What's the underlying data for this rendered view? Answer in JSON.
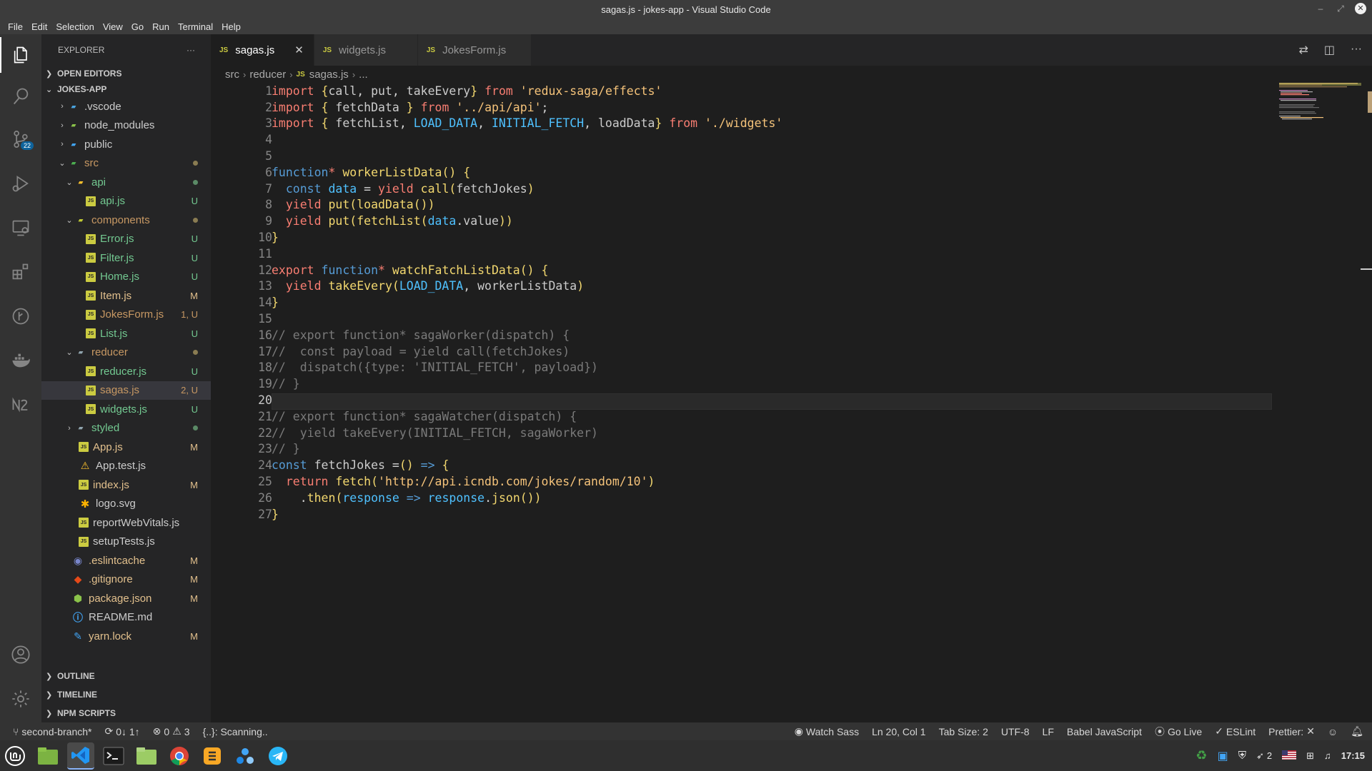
{
  "window": {
    "title": "sagas.js - jokes-app - Visual Studio Code"
  },
  "menu": [
    "File",
    "Edit",
    "Selection",
    "View",
    "Go",
    "Run",
    "Terminal",
    "Help"
  ],
  "activity": {
    "scm_badge": "22"
  },
  "explorer": {
    "header": "EXPLORER",
    "more": "···",
    "open_editors": "OPEN EDITORS",
    "project": "JOKES-APP",
    "tree": [
      {
        "label": ".vscode",
        "status": ""
      },
      {
        "label": "node_modules",
        "status": ""
      },
      {
        "label": "public",
        "status": ""
      },
      {
        "label": "src",
        "status": ""
      },
      {
        "label": "api",
        "status": ""
      },
      {
        "label": "api.js",
        "status": "U"
      },
      {
        "label": "components",
        "status": ""
      },
      {
        "label": "Error.js",
        "status": "U"
      },
      {
        "label": "Filter.js",
        "status": "U"
      },
      {
        "label": "Home.js",
        "status": "U"
      },
      {
        "label": "Item.js",
        "status": "M"
      },
      {
        "label": "JokesForm.js",
        "status": "1, U"
      },
      {
        "label": "List.js",
        "status": "U"
      },
      {
        "label": "reducer",
        "status": ""
      },
      {
        "label": "reducer.js",
        "status": "U"
      },
      {
        "label": "sagas.js",
        "status": "2, U"
      },
      {
        "label": "widgets.js",
        "status": "U"
      },
      {
        "label": "styled",
        "status": ""
      },
      {
        "label": "App.js",
        "status": "M"
      },
      {
        "label": "App.test.js",
        "status": ""
      },
      {
        "label": "index.js",
        "status": "M"
      },
      {
        "label": "logo.svg",
        "status": ""
      },
      {
        "label": "reportWebVitals.js",
        "status": ""
      },
      {
        "label": "setupTests.js",
        "status": ""
      },
      {
        "label": ".eslintcache",
        "status": "M"
      },
      {
        "label": ".gitignore",
        "status": "M"
      },
      {
        "label": "package.json",
        "status": "M"
      },
      {
        "label": "README.md",
        "status": ""
      },
      {
        "label": "yarn.lock",
        "status": "M"
      }
    ],
    "outline": "OUTLINE",
    "timeline": "TIMELINE",
    "npm_scripts": "NPM SCRIPTS"
  },
  "tabs": [
    {
      "label": "sagas.js"
    },
    {
      "label": "widgets.js"
    },
    {
      "label": "JokesForm.js"
    }
  ],
  "breadcrumb": [
    "src",
    "reducer",
    "sagas.js",
    "..."
  ],
  "code": [
    "import {call, put, takeEvery} from 'redux-saga/effects'",
    "import { fetchData } from '../api/api';",
    "import { fetchList, LOAD_DATA, INITIAL_FETCH, loadData} from './widgets'",
    "",
    "",
    "function* workerListData() {",
    "  const data = yield call(fetchJokes)",
    "  yield put(loadData())",
    "  yield put(fetchList(data.value))",
    "}",
    "",
    "export function* watchFatchListData() {",
    "  yield takeEvery(LOAD_DATA, workerListData)",
    "}",
    "",
    "// export function* sagaWorker(dispatch) {",
    "//  const payload = yield call(fetchJokes)",
    "//  dispatch({type: 'INITIAL_FETCH', payload})",
    "// }",
    "",
    "// export function* sagaWatcher(dispatch) {",
    "//  yield takeEvery(INITIAL_FETCH, sagaWorker)",
    "// }",
    "const fetchJokes =() => {",
    "  return fetch('http://api.icndb.com/jokes/random/10')",
    "    .then(response => response.json())",
    "}"
  ],
  "line_numbers": [
    "1",
    "2",
    "3",
    "4",
    "5",
    "6",
    "7",
    "8",
    "9",
    "10",
    "11",
    "12",
    "13",
    "14",
    "15",
    "16",
    "17",
    "18",
    "19",
    "20",
    "21",
    "22",
    "23",
    "24",
    "25",
    "26",
    "27"
  ],
  "status": {
    "branch": "second-branch*",
    "sync": "0↓ 1↑",
    "errors": "0",
    "warnings": "3",
    "scanning": "{..}: Scanning..",
    "watch_sass": "Watch Sass",
    "position": "Ln 20, Col 1",
    "tab_size": "Tab Size: 2",
    "encoding": "UTF-8",
    "eol": "LF",
    "language": "Babel JavaScript",
    "go_live": "Go Live",
    "eslint": "ESLint",
    "prettier": "Prettier:"
  },
  "tray": {
    "notif_count": "2",
    "clock": "17:15"
  }
}
